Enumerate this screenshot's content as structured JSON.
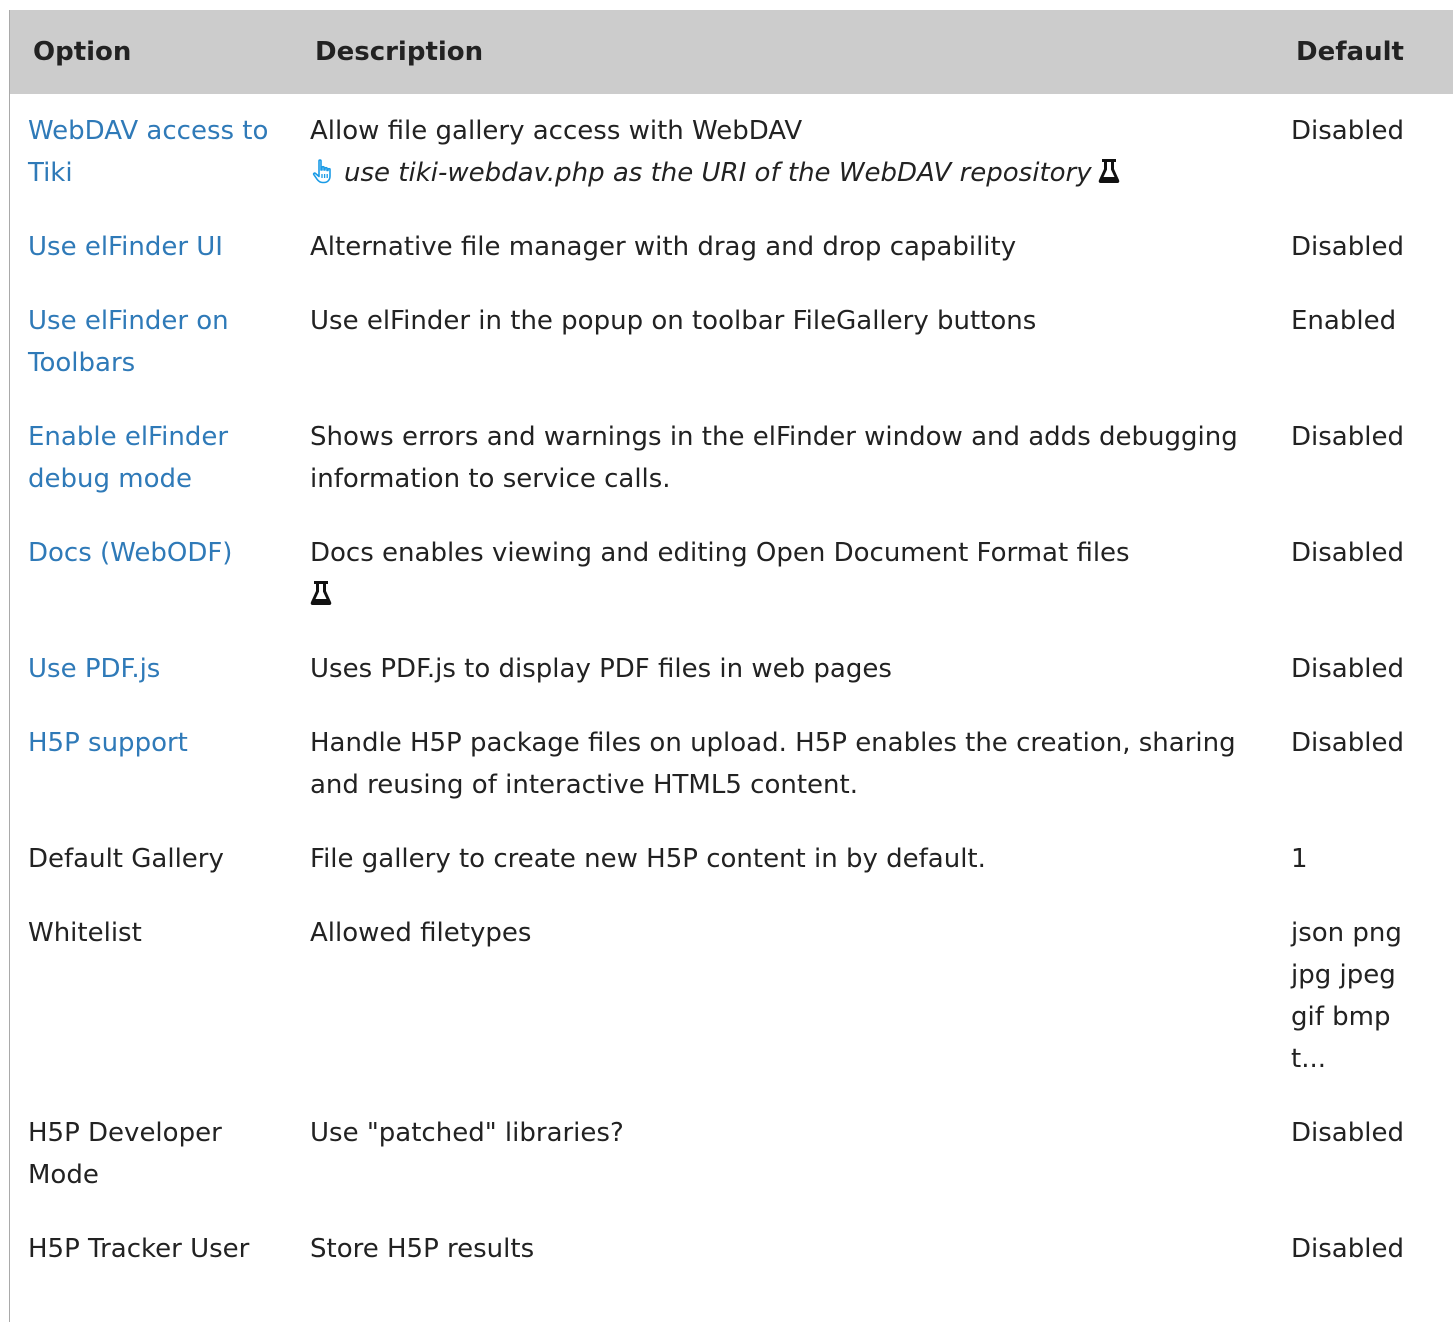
{
  "table": {
    "headers": {
      "option": "Option",
      "description": "Description",
      "default": "Default"
    },
    "rows": [
      {
        "option": "WebDAV access to Tiki",
        "link": true,
        "description": "Allow file gallery access with WebDAV",
        "note": "use tiki-webdav.php as the URI of the WebDAV repository",
        "default": "Disabled"
      },
      {
        "option": "Use elFinder UI",
        "link": true,
        "description": "Alternative file manager with drag and drop capability",
        "default": "Disabled"
      },
      {
        "option": "Use elFinder on Toolbars",
        "link": true,
        "description": "Use elFinder in the popup on toolbar FileGallery buttons",
        "default": "Enabled"
      },
      {
        "option": "Enable elFinder debug mode",
        "link": true,
        "description": "Shows errors and warnings in the elFinder window and adds debugging information to service calls.",
        "default": "Disabled"
      },
      {
        "option": "Docs (WebODF)",
        "link": true,
        "description": "Docs enables viewing and editing Open Document Format files",
        "default": "Disabled"
      },
      {
        "option": "Use PDF.js",
        "link": true,
        "description": "Uses PDF.js to display PDF files in web pages",
        "default": "Disabled"
      },
      {
        "option": "H5P support",
        "link": true,
        "description": "Handle H5P package files on upload. H5P enables the creation, sharing and reusing of interactive HTML5 content.",
        "default": "Disabled"
      },
      {
        "option": "Default Gallery",
        "link": false,
        "description": "File gallery to create new H5P content in by default.",
        "default": "1"
      },
      {
        "option": "Whitelist",
        "link": false,
        "description": "Allowed filetypes",
        "default_lines": [
          "json png",
          "jpg jpeg",
          "gif bmp",
          "t..."
        ]
      },
      {
        "option": "H5P Developer Mode",
        "link": false,
        "description": "Use \"patched\" libraries?",
        "default": "Disabled"
      },
      {
        "option": "H5P Tracker User",
        "link": false,
        "description": "Store H5P results",
        "default": "Disabled"
      }
    ]
  },
  "icons": {
    "hand": "pointing-hand-icon",
    "flask": "experimental-flask-icon"
  },
  "colors": {
    "link": "#2f7ab8",
    "header_bg": "#cccccc",
    "hand_icon": "#1a9be6"
  }
}
